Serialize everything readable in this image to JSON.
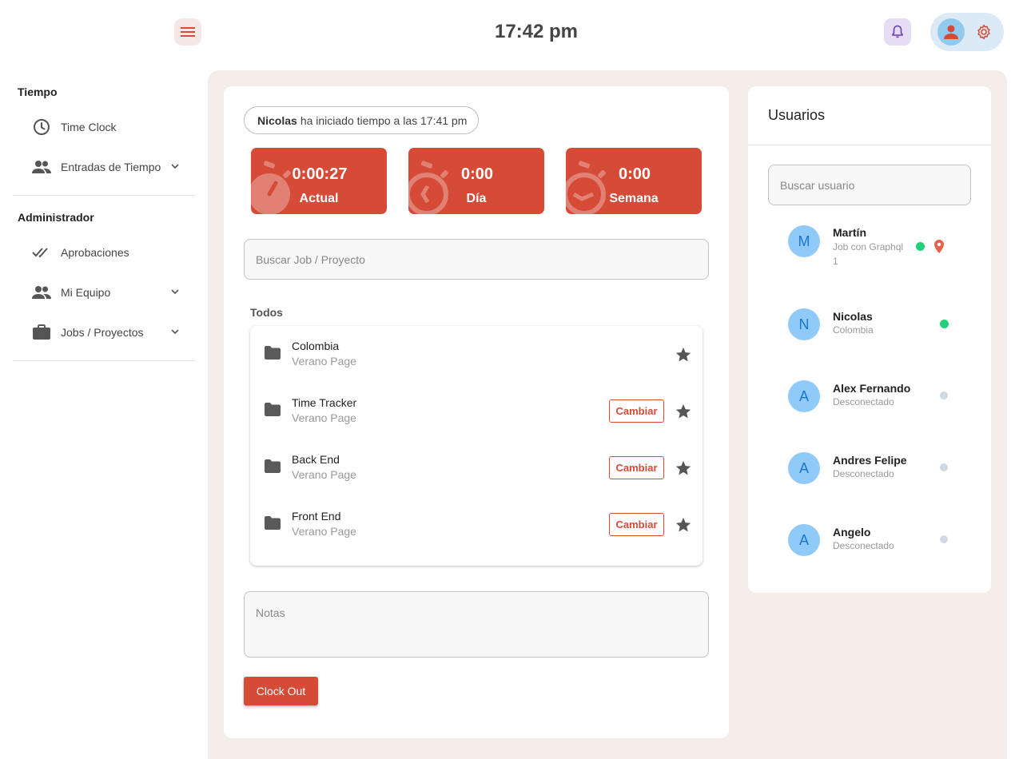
{
  "header": {
    "clock": "17:42 pm"
  },
  "sidebar": {
    "sections": [
      {
        "title": "Tiempo"
      },
      {
        "title": "Administrador"
      }
    ],
    "items": [
      {
        "label": "Time Clock"
      },
      {
        "label": "Entradas de Tiempo"
      },
      {
        "label": "Aprobaciones"
      },
      {
        "label": "Mi Equipo"
      },
      {
        "label": "Jobs / Proyectos"
      }
    ]
  },
  "status": {
    "user": "Nicolas",
    "message": "ha iniciado tiempo a las 17:41 pm"
  },
  "timers": [
    {
      "value": "0:00:27",
      "label": "Actual"
    },
    {
      "value": "0:00",
      "label": "Día"
    },
    {
      "value": "0:00",
      "label": "Semana"
    }
  ],
  "job_search": {
    "placeholder": "Buscar Job / Proyecto"
  },
  "projects": {
    "group_label": "Todos",
    "change_label": "Cambiar",
    "items": [
      {
        "name": "Colombia",
        "subtitle": "Verano Page"
      },
      {
        "name": "Time Tracker",
        "subtitle": "Verano Page"
      },
      {
        "name": "Back End",
        "subtitle": "Verano Page"
      },
      {
        "name": "Front End",
        "subtitle": "Verano Page"
      }
    ]
  },
  "notes": {
    "placeholder": "Notas"
  },
  "clock_out": {
    "label": "Clock Out"
  },
  "users_panel": {
    "title": "Usuarios",
    "search_placeholder": "Buscar usuario",
    "users": [
      {
        "initial": "M",
        "name": "Martín",
        "status": "Job con Graphql 1"
      },
      {
        "initial": "N",
        "name": "Nicolas",
        "status": "Colombia"
      },
      {
        "initial": "A",
        "name": "Alex Fernando",
        "status": "Desconectado"
      },
      {
        "initial": "A",
        "name": "Andres Felipe",
        "status": "Desconectado"
      },
      {
        "initial": "A",
        "name": "Angelo",
        "status": "Desconectado"
      }
    ]
  },
  "colors": {
    "accent": "#d54b38",
    "online": "#2ecc71",
    "offline": "#cfd8e3",
    "location": "#e8604c"
  }
}
